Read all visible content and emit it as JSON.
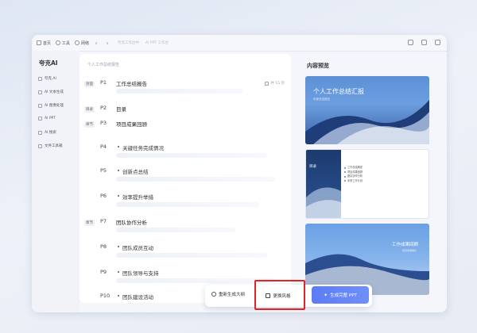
{
  "topbar": {
    "home": "首页",
    "tools": "工具",
    "network": "网络",
    "breadcrumb1": "夸克工作台中",
    "breadcrumb2": "AI PPT 工作台"
  },
  "sidebar": {
    "brand": "夸克AI",
    "items": [
      {
        "label": "夸克 AI"
      },
      {
        "label": "AI 文本生成"
      },
      {
        "label": "AI 图像处理"
      },
      {
        "label": "AI PPT"
      },
      {
        "label": "AI 搜索"
      },
      {
        "label": "文件工具箱"
      }
    ]
  },
  "outline": {
    "doc_title": "个人工作总结报告",
    "word_count": "共 15 页",
    "rows": [
      {
        "tag": "封面",
        "page": "P1",
        "title": "工作总结报告",
        "sub": false
      },
      {
        "tag": "目录",
        "page": "P2",
        "title": "目录",
        "sub": false
      },
      {
        "tag": "章节",
        "page": "P3",
        "title": "项目成果回顾",
        "sub": false
      },
      {
        "tag": "",
        "page": "P4",
        "title": "关键任务完成情况",
        "sub": true
      },
      {
        "tag": "",
        "page": "P5",
        "title": "创新点总结",
        "sub": true
      },
      {
        "tag": "",
        "page": "P6",
        "title": "效率提升举措",
        "sub": true
      },
      {
        "tag": "章节",
        "page": "P7",
        "title": "团队协作分析",
        "sub": false
      },
      {
        "tag": "",
        "page": "P8",
        "title": "团队成员互动",
        "sub": true
      },
      {
        "tag": "",
        "page": "P9",
        "title": "团队领导与支持",
        "sub": true
      },
      {
        "tag": "",
        "page": "P10",
        "title": "团队建设活动",
        "sub": true
      }
    ]
  },
  "preview": {
    "label": "内容预览",
    "slide1_title": "个人工作总结汇报",
    "slide1_sub": "年度总结报告",
    "slide2_head": "目录",
    "slide2_items": [
      "工作总结概述",
      "项目成果回顾",
      "团队协作分析",
      "未来工作计划"
    ],
    "slide3_title": "工作成果回顾",
    "slide3_sub": "项目成果展示"
  },
  "footer": {
    "regen": "重新生成大纲",
    "change_style": "更换风格",
    "generate": "生成完整 PPT"
  },
  "colors": {
    "accent": "#5b7cf6",
    "highlight": "#e02424"
  }
}
